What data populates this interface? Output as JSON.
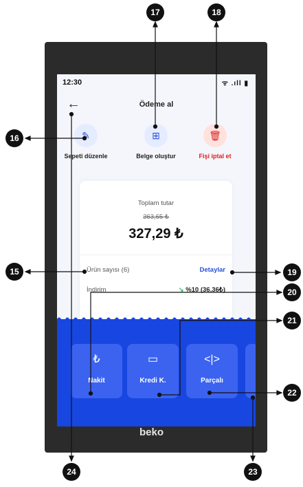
{
  "status_bar": {
    "time": "12:30",
    "icons": "ᯤ .ıll ▮"
  },
  "header": {
    "back_icon": "←",
    "title": "Ödeme al"
  },
  "actions": [
    {
      "label": "Sepeti düzenle",
      "icon": "✎",
      "color": "#222222",
      "bg": "#e6ecff",
      "icon_color": "#2a4fd6"
    },
    {
      "label": "Belge oluştur",
      "icon": "⊞",
      "color": "#222222",
      "bg": "#e6ecff",
      "icon_color": "#2a4fd6"
    },
    {
      "label": "Fişi iptal et",
      "icon": "🗑",
      "color": "#e02020",
      "bg": "#ffe1dd",
      "icon_color": "#e02020"
    }
  ],
  "summary": {
    "total_label": "Toplam tutar",
    "old_total": "363,65 ₺",
    "total": "327,29 ₺",
    "item_count_label": "Ürün sayısı (6)",
    "details_link": "Detaylar",
    "discount_label": "İndirim",
    "discount_arrow": "↘",
    "discount_value": "%10 (36,36₺)"
  },
  "payment_methods": [
    {
      "label": "Nakit",
      "icon": "₺"
    },
    {
      "label": "Kredi K.",
      "icon": "▭"
    },
    {
      "label": "Parçalı",
      "icon": "<|>"
    }
  ],
  "brand": "beko",
  "annotations": [
    "15",
    "16",
    "17",
    "18",
    "19",
    "20",
    "21",
    "22",
    "23",
    "24"
  ],
  "colors": {
    "accent": "#1846e0",
    "tile": "#3b63f0",
    "danger": "#e02020",
    "positive": "#2fbf71"
  }
}
